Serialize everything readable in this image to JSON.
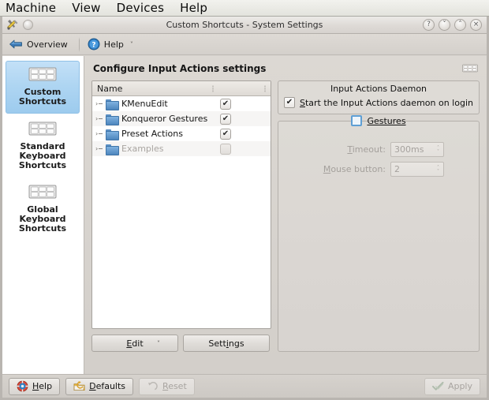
{
  "host_menubar": {
    "items": [
      {
        "label": "Machine"
      },
      {
        "label": "View"
      },
      {
        "label": "Devices"
      },
      {
        "label": "Help"
      }
    ]
  },
  "window": {
    "title": "Custom Shortcuts - System Settings",
    "icon": "tools-icon",
    "controls": [
      {
        "name": "help-button",
        "glyph": "?"
      },
      {
        "name": "shade-button",
        "glyph": "˅"
      },
      {
        "name": "maximize-button",
        "glyph": "˄"
      },
      {
        "name": "close-button",
        "glyph": "×"
      }
    ]
  },
  "toolbar": {
    "overview_label": "Overview",
    "help_label": "Help",
    "overview_icon": "back-arrow-icon",
    "help_icon": "help-circle-icon",
    "more_icon": "chevron-down-icon"
  },
  "sidebar": {
    "items": [
      {
        "label": "Custom\nShortcuts",
        "icon": "keyboard-icon",
        "selected": true
      },
      {
        "label": "Standard\nKeyboard\nShortcuts",
        "icon": "keyboard-icon",
        "selected": false
      },
      {
        "label": "Global\nKeyboard\nShortcuts",
        "icon": "keyboard-icon",
        "selected": false
      }
    ]
  },
  "main": {
    "title": "Configure Input Actions settings",
    "header_icon": "keyboard-icon"
  },
  "tree": {
    "column_header": "Name",
    "rows": [
      {
        "label": "KMenuEdit",
        "checked": true,
        "enabled": true,
        "icon": "folder-icon",
        "expander": "›"
      },
      {
        "label": "Konqueror Gestures",
        "checked": true,
        "enabled": true,
        "icon": "folder-icon",
        "expander": "›"
      },
      {
        "label": "Preset Actions",
        "checked": true,
        "enabled": true,
        "icon": "folder-icon",
        "expander": "›"
      },
      {
        "label": "Examples",
        "checked": false,
        "enabled": false,
        "icon": "folder-icon",
        "expander": "›"
      }
    ],
    "check_glyph": "✔",
    "buttons": {
      "edit_label": "Edit",
      "edit_chevron": "˅",
      "settings_label": "Settings"
    }
  },
  "daemon_group": {
    "title": "Input Actions Daemon",
    "checkbox_label": "Start the Input Actions daemon on login",
    "checkbox_checked": true,
    "check_glyph": "✔"
  },
  "gestures_group": {
    "title": "Gestures",
    "checkbox_checked": false,
    "fields": [
      {
        "label": "Timeout:",
        "value": "300ms",
        "enabled": false
      },
      {
        "label": "Mouse button:",
        "value": "2",
        "enabled": false
      }
    ],
    "spin_up": "˄",
    "spin_down": "˅"
  },
  "bottombar": {
    "help_label": "Help",
    "defaults_label": "Defaults",
    "reset_label": "Reset",
    "apply_label": "Apply",
    "help_icon": "lifebuoy-icon",
    "defaults_icon": "undo-folder-icon",
    "reset_icon": "undo-arrow-icon",
    "apply_icon": "check-icon",
    "reset_enabled": false,
    "apply_enabled": false
  },
  "colors": {
    "selection_blue": "#aed5f2",
    "folder_blue": "#5a8fc4",
    "window_bg": "#d8d4cf",
    "accent_focus": "#5f9fd4"
  }
}
